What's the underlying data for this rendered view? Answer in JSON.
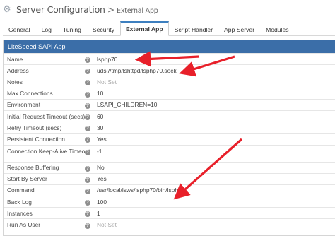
{
  "header": {
    "icon": "gear-icon",
    "title": "Server Configuration",
    "separator": ">",
    "subtitle": "External App"
  },
  "tabs": [
    {
      "label": "General",
      "active": false
    },
    {
      "label": "Log",
      "active": false
    },
    {
      "label": "Tuning",
      "active": false
    },
    {
      "label": "Security",
      "active": false
    },
    {
      "label": "External App",
      "active": true
    },
    {
      "label": "Script Handler",
      "active": false
    },
    {
      "label": "App Server",
      "active": false
    },
    {
      "label": "Modules",
      "active": false
    }
  ],
  "panel": {
    "title": "LiteSpeed SAPI App",
    "help_icon": "help-icon",
    "help_glyph": "?",
    "rows": [
      {
        "label": "Name",
        "value": "lsphp70"
      },
      {
        "label": "Address",
        "value": "uds://tmp/lshttpd/lsphp70.sock"
      },
      {
        "label": "Notes",
        "value": "Not Set"
      },
      {
        "label": "Max Connections",
        "value": "10"
      },
      {
        "label": "Environment",
        "value": "LSAPI_CHILDREN=10"
      },
      {
        "label": "Initial Request Timeout (secs)",
        "value": "60"
      },
      {
        "label": "Retry Timeout (secs)",
        "value": "30"
      },
      {
        "label": "Persistent Connection",
        "value": "Yes"
      },
      {
        "label": "Connection Keep-Alive Timeout",
        "value": "-1"
      },
      {
        "label": "Response Buffering",
        "value": "No"
      },
      {
        "label": "Start By Server",
        "value": "Yes"
      },
      {
        "label": "Command",
        "value": "/usr/local/lsws/lsphp70/bin/lsphp"
      },
      {
        "label": "Back Log",
        "value": "100"
      },
      {
        "label": "Instances",
        "value": "1"
      },
      {
        "label": "Run As User",
        "value": "Not Set"
      }
    ]
  },
  "colors": {
    "accent": "#3b6ea8",
    "arrow": "#e8202a",
    "muted": "#aaaaaa"
  }
}
